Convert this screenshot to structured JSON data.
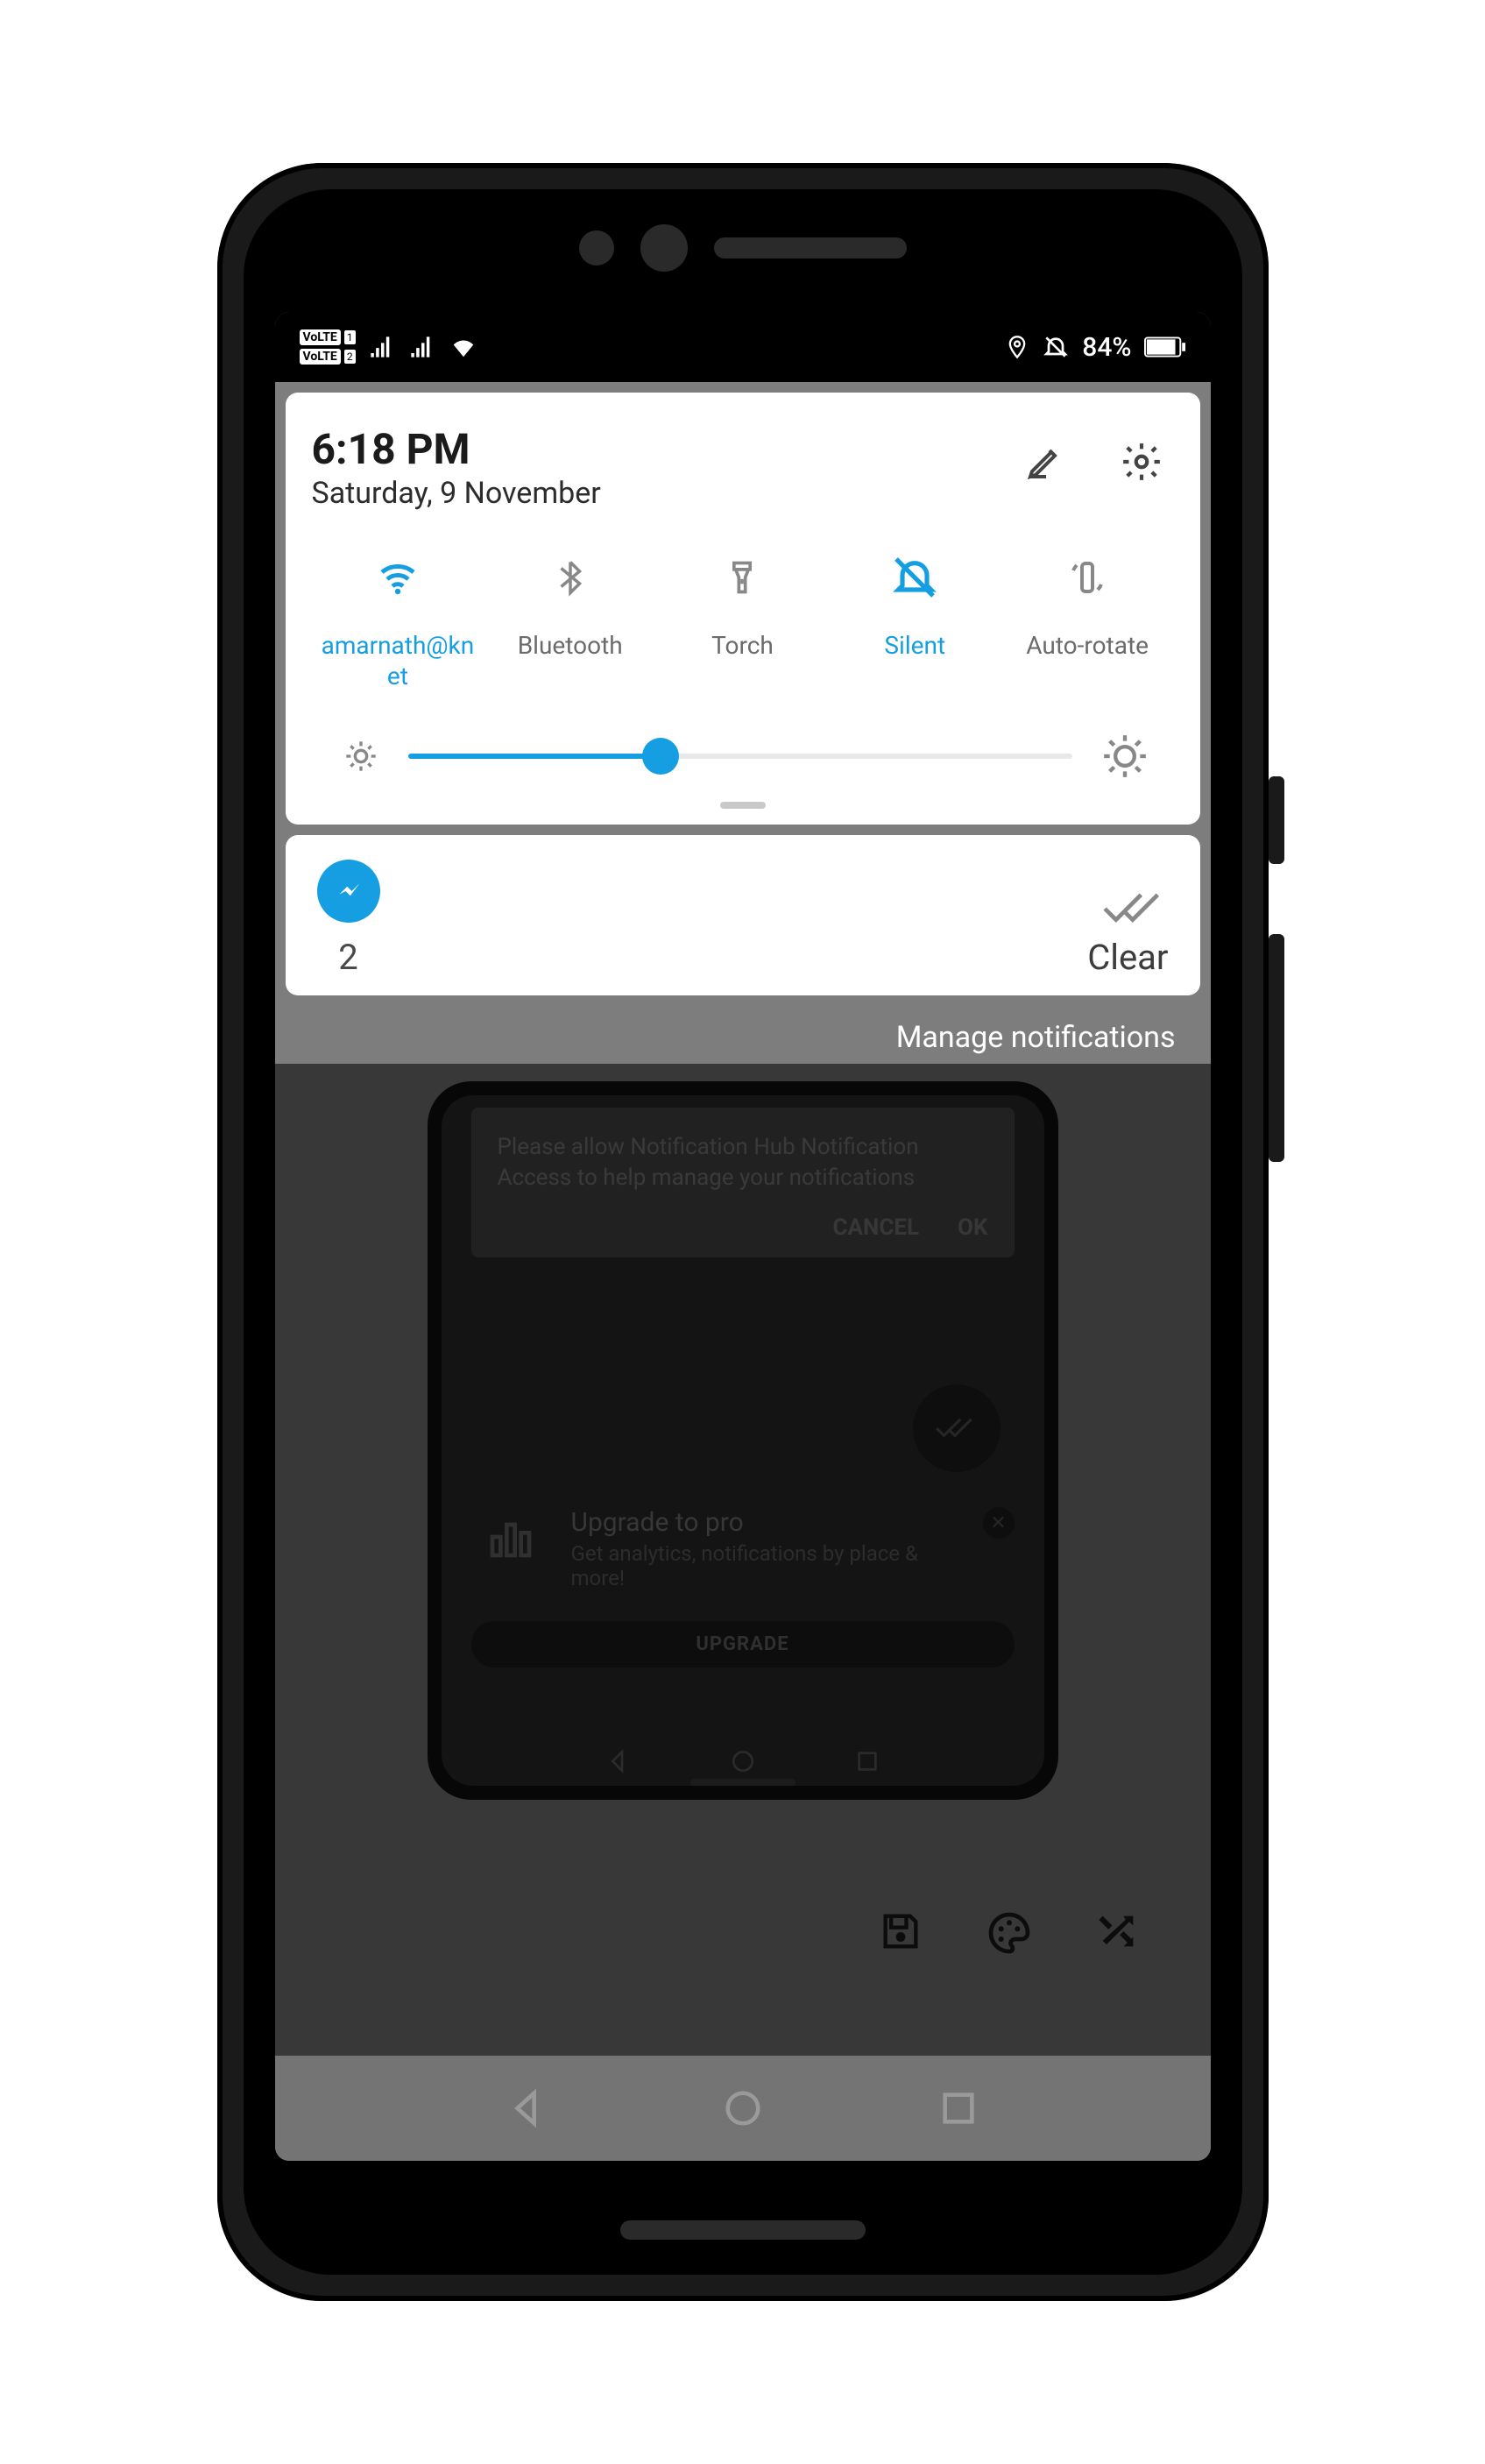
{
  "status": {
    "volte1": "VoLTE",
    "sub1": "1",
    "volte2": "VoLTE",
    "sub2": "2",
    "battery": "84%"
  },
  "qs": {
    "time": "6:18 PM",
    "date": "Saturday, 9 November",
    "tiles": {
      "wifi": "amarnath@knet",
      "bt": "Bluetooth",
      "torch": "Torch",
      "silent": "Silent",
      "rotate": "Auto-rotate"
    }
  },
  "notif": {
    "count": "2",
    "clear": "Clear"
  },
  "manage": "Manage notifications",
  "modal": {
    "text": "Please allow Notification Hub Notification Access to help manage your notifications",
    "cancel": "CANCEL",
    "ok": "OK"
  },
  "upgrade": {
    "title": "Upgrade to pro",
    "subtitle": "Get analytics, notifications by place & more!",
    "button": "UPGRADE"
  }
}
